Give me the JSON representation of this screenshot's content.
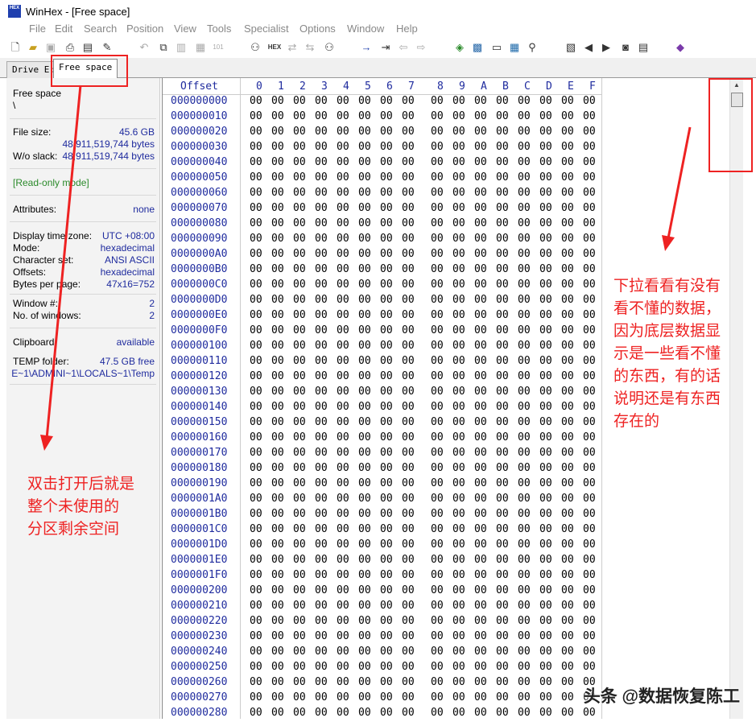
{
  "window": {
    "title": "WinHex - [Free space]",
    "icon_text": "HEX"
  },
  "menu": [
    "File",
    "Edit",
    "Search",
    "Position",
    "View",
    "Tools",
    "Specialist",
    "Options",
    "Window",
    "Help"
  ],
  "toolbar_icons": [
    "new-file",
    "open-folder",
    "save",
    "print",
    "properties",
    "undo",
    "copy",
    "paste",
    "paste-special",
    "binary",
    "find",
    "find-hex",
    "replace-text",
    "replace-hex",
    "find-next",
    "goto-offset",
    "goto-sector",
    "back",
    "forward",
    "disk-edit",
    "open-disk",
    "ram",
    "calculator",
    "zoom",
    "file-manager",
    "prev",
    "next",
    "camera",
    "table",
    "book"
  ],
  "tabs": [
    {
      "label": "Drive E:"
    },
    {
      "label": "Free space"
    }
  ],
  "info": {
    "name": "Free space",
    "path": "\\",
    "file_size_label": "File size:",
    "file_size_gb": "45.6 GB",
    "file_size_bytes": "48,911,519,744 bytes",
    "wo_slack_label": "W/o slack:",
    "wo_slack_bytes": "48,911,519,744 bytes",
    "mode_note": "[Read-only mode]",
    "attributes_label": "Attributes:",
    "attributes_value": "none",
    "tz_label": "Display time zone:",
    "tz_value": "UTC +08:00",
    "mode_label": "Mode:",
    "mode_value": "hexadecimal",
    "charset_label": "Character set:",
    "charset_value": "ANSI ASCII",
    "offsets_label": "Offsets:",
    "offsets_value": "hexadecimal",
    "bpp_label": "Bytes per page:",
    "bpp_value": "47x16=752",
    "window_no_label": "Window #:",
    "window_no_value": "2",
    "num_windows_label": "No. of windows:",
    "num_windows_value": "2",
    "clipboard_label": "Clipboard:",
    "clipboard_value": "available",
    "temp_label": "TEMP folder:",
    "temp_value": "47.5 GB free",
    "temp_path": "E~1\\ADMINI~1\\LOCALS~1\\Temp"
  },
  "hex": {
    "offset_header": "Offset",
    "columns": [
      "0",
      "1",
      "2",
      "3",
      "4",
      "5",
      "6",
      "7",
      "8",
      "9",
      "A",
      "B",
      "C",
      "D",
      "E",
      "F"
    ],
    "byte_value": "00",
    "offsets": [
      "000000000",
      "000000010",
      "000000020",
      "000000030",
      "000000040",
      "000000050",
      "000000060",
      "000000070",
      "000000080",
      "000000090",
      "0000000A0",
      "0000000B0",
      "0000000C0",
      "0000000D0",
      "0000000E0",
      "0000000F0",
      "000000100",
      "000000110",
      "000000120",
      "000000130",
      "000000140",
      "000000150",
      "000000160",
      "000000170",
      "000000180",
      "000000190",
      "0000001A0",
      "0000001B0",
      "0000001C0",
      "0000001D0",
      "0000001E0",
      "0000001F0",
      "000000200",
      "000000210",
      "000000220",
      "000000230",
      "000000240",
      "000000250",
      "000000260",
      "000000270",
      "000000280"
    ]
  },
  "annotations": {
    "left_note": "双击打开后就是\n整个未使用的\n分区剩余空间",
    "right_note": "下拉看看有没有\n看不懂的数据，\n因为底层数据显\n示是一些看不懂\n的东西，有的话\n说明还是有东西\n存在的",
    "watermark": "头条 @数据恢复陈工",
    "color": "#e22222"
  }
}
